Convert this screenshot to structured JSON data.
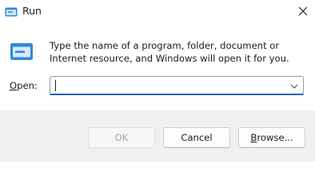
{
  "window": {
    "title": "Run",
    "app_icon": "run-icon",
    "close_icon": "close-icon"
  },
  "content": {
    "icon": "run-dialog-icon",
    "description": "Type the name of a program, folder, document or Internet resource, and Windows will open it for you."
  },
  "open_field": {
    "label_mnemonic": "O",
    "label_rest": "pen:",
    "value": "",
    "placeholder": "",
    "dropdown_icon": "chevron-down-icon"
  },
  "buttons": {
    "ok": "OK",
    "cancel": "Cancel",
    "browse_mnemonic": "B",
    "browse_rest": "rowse..."
  },
  "colors": {
    "accent": "#1c63c4",
    "footer_bg": "#f0f0f0",
    "icon_blue": "#2f86e0"
  }
}
